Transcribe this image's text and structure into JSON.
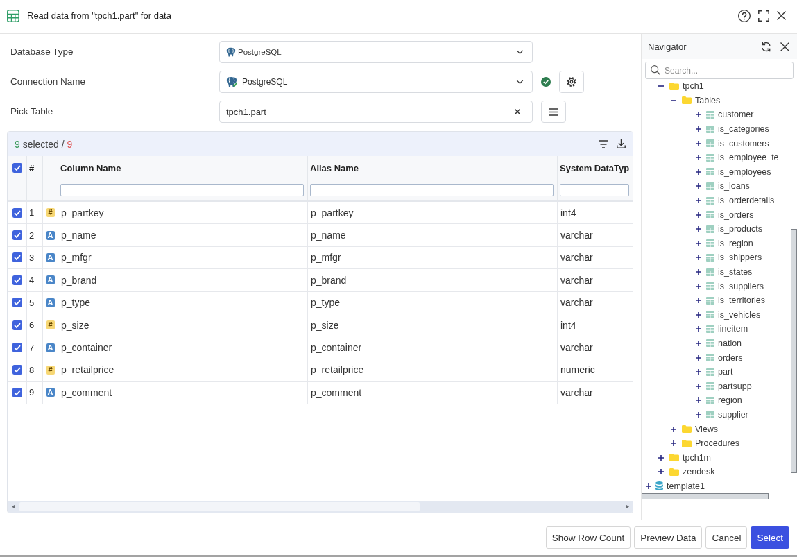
{
  "window": {
    "title": "Read data from \"tpch1.part\" for data"
  },
  "form": {
    "database_type": {
      "label": "Database Type",
      "value": "PostgreSQL"
    },
    "connection_name": {
      "label": "Connection Name",
      "value": "PostgreSQL",
      "connected": true
    },
    "pick_table": {
      "label": "Pick Table",
      "value": "tpch1.part"
    }
  },
  "table": {
    "selected_count": "9",
    "selected_label": "selected",
    "separator": "/",
    "total_count": "9",
    "all_checked": true,
    "columns": [
      {
        "label": "#",
        "filter": false
      },
      {
        "label": "Column Name",
        "filter": true
      },
      {
        "label": "Alias Name",
        "filter": true
      },
      {
        "label": "System DataTyp",
        "filter": true
      }
    ],
    "rows": [
      {
        "checked": true,
        "number": "1",
        "kind": "numeric",
        "type_glyph": "#",
        "column_name": "p_partkey",
        "alias_name": "p_partkey",
        "system_datatype": "int4"
      },
      {
        "checked": true,
        "number": "2",
        "kind": "text",
        "type_glyph": "A",
        "column_name": "p_name",
        "alias_name": "p_name",
        "system_datatype": "varchar"
      },
      {
        "checked": true,
        "number": "3",
        "kind": "text",
        "type_glyph": "A",
        "column_name": "p_mfgr",
        "alias_name": "p_mfgr",
        "system_datatype": "varchar"
      },
      {
        "checked": true,
        "number": "4",
        "kind": "text",
        "type_glyph": "A",
        "column_name": "p_brand",
        "alias_name": "p_brand",
        "system_datatype": "varchar"
      },
      {
        "checked": true,
        "number": "5",
        "kind": "text",
        "type_glyph": "A",
        "column_name": "p_type",
        "alias_name": "p_type",
        "system_datatype": "varchar"
      },
      {
        "checked": true,
        "number": "6",
        "kind": "numeric",
        "type_glyph": "#",
        "column_name": "p_size",
        "alias_name": "p_size",
        "system_datatype": "int4"
      },
      {
        "checked": true,
        "number": "7",
        "kind": "text",
        "type_glyph": "A",
        "column_name": "p_container",
        "alias_name": "p_container",
        "system_datatype": "varchar"
      },
      {
        "checked": true,
        "number": "8",
        "kind": "numeric",
        "type_glyph": "#",
        "column_name": "p_retailprice",
        "alias_name": "p_retailprice",
        "system_datatype": "numeric"
      },
      {
        "checked": true,
        "number": "9",
        "kind": "text",
        "type_glyph": "A",
        "column_name": "p_comment",
        "alias_name": "p_comment",
        "system_datatype": "varchar"
      }
    ]
  },
  "navigator": {
    "title": "Navigator",
    "search": {
      "placeholder": "Search..."
    },
    "tree": [
      {
        "children": [
          {
            "label": "tpch1",
            "kind": "folder",
            "expanded": true,
            "children": [
              {
                "label": "Tables",
                "kind": "folder",
                "expanded": true,
                "children": [
                  {
                    "label": "customer",
                    "kind": "table",
                    "expanded": false
                  },
                  {
                    "label": "is_categories",
                    "kind": "table",
                    "expanded": false
                  },
                  {
                    "label": "is_customers",
                    "kind": "table",
                    "expanded": false
                  },
                  {
                    "label": "is_employee_te",
                    "kind": "table",
                    "expanded": false
                  },
                  {
                    "label": "is_employees",
                    "kind": "table",
                    "expanded": false
                  },
                  {
                    "label": "is_loans",
                    "kind": "table",
                    "expanded": false
                  },
                  {
                    "label": "is_orderdetails",
                    "kind": "table",
                    "expanded": false
                  },
                  {
                    "label": "is_orders",
                    "kind": "table",
                    "expanded": false
                  },
                  {
                    "label": "is_products",
                    "kind": "table",
                    "expanded": false
                  },
                  {
                    "label": "is_region",
                    "kind": "table",
                    "expanded": false
                  },
                  {
                    "label": "is_shippers",
                    "kind": "table",
                    "expanded": false
                  },
                  {
                    "label": "is_states",
                    "kind": "table",
                    "expanded": false
                  },
                  {
                    "label": "is_suppliers",
                    "kind": "table",
                    "expanded": false
                  },
                  {
                    "label": "is_territories",
                    "kind": "table",
                    "expanded": false
                  },
                  {
                    "label": "is_vehicles",
                    "kind": "table",
                    "expanded": false
                  },
                  {
                    "label": "lineitem",
                    "kind": "table",
                    "expanded": false
                  },
                  {
                    "label": "nation",
                    "kind": "table",
                    "expanded": false
                  },
                  {
                    "label": "orders",
                    "kind": "table",
                    "expanded": false
                  },
                  {
                    "label": "part",
                    "kind": "table",
                    "expanded": false
                  },
                  {
                    "label": "partsupp",
                    "kind": "table",
                    "expanded": false
                  },
                  {
                    "label": "region",
                    "kind": "table",
                    "expanded": false
                  },
                  {
                    "label": "supplier",
                    "kind": "table",
                    "expanded": false
                  }
                ]
              },
              {
                "label": "Views",
                "kind": "folder",
                "expanded": false
              },
              {
                "label": "Procedures",
                "kind": "folder",
                "expanded": false
              }
            ]
          },
          {
            "label": "tpch1m",
            "kind": "folder",
            "expanded": false
          },
          {
            "label": "zendesk",
            "kind": "folder",
            "expanded": false
          }
        ]
      },
      {
        "label": "template1",
        "kind": "database",
        "expanded": false
      }
    ]
  },
  "buttons": [
    {
      "label": "Show Row Count",
      "primary": false
    },
    {
      "label": "Preview Data",
      "primary": false
    },
    {
      "label": "Cancel",
      "primary": false
    },
    {
      "label": "Select",
      "primary": true
    }
  ]
}
